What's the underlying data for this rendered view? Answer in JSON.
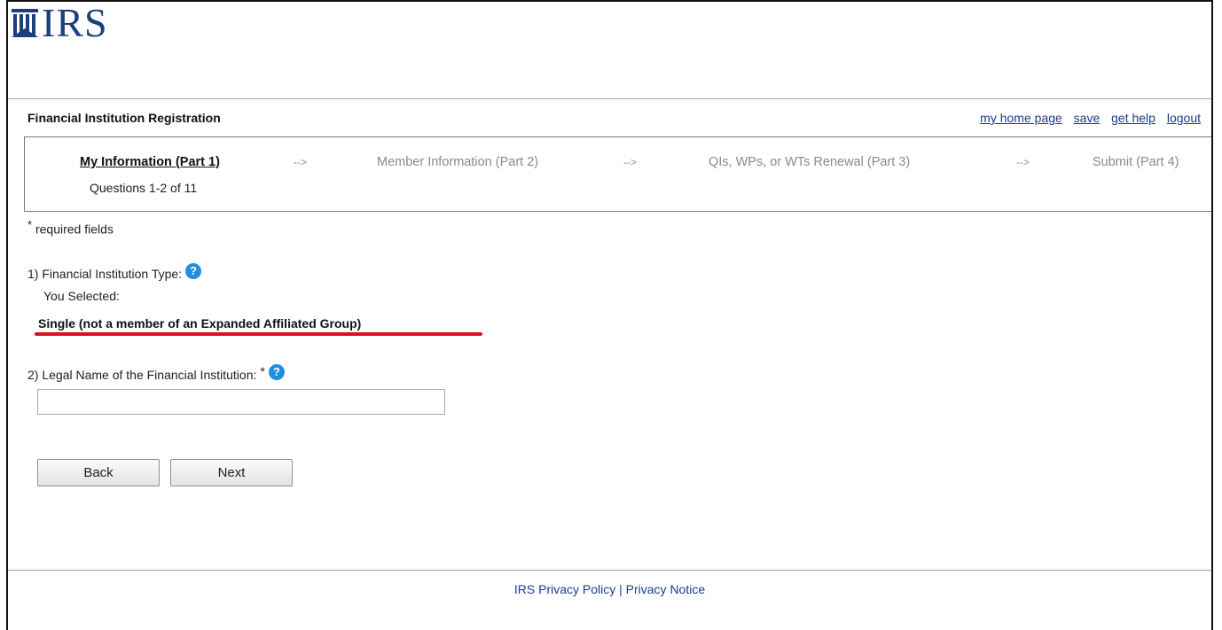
{
  "header": {
    "logo_text": "IRS",
    "app_title": "Financial Institution Registration",
    "links": [
      "my home page",
      "save",
      "get help",
      "logout"
    ]
  },
  "steps": {
    "items": [
      {
        "label": "My Information (Part 1)",
        "current": true
      },
      {
        "label": "Member Information (Part 2)",
        "current": false
      },
      {
        "label": "QIs, WPs, or WTs Renewal (Part 3)",
        "current": false
      },
      {
        "label": "Submit (Part 4)",
        "current": false
      }
    ],
    "arrow": "-->",
    "progress_text": "Questions 1-2 of 11"
  },
  "form": {
    "required_note_mark": "*",
    "required_note_text": "required fields",
    "q1_label": "1) Financial Institution Type:",
    "q1_you_selected": "You Selected:",
    "q1_value": "Single (not a member of an Expanded Affiliated Group)",
    "q2_label": "2) Legal Name of the Financial Institution:",
    "q2_required_mark": "*",
    "q2_value": "",
    "help_icon_glyph": "?",
    "back_label": "Back",
    "next_label": "Next"
  },
  "footer": {
    "privacy_policy": "IRS Privacy Policy",
    "separator": "|",
    "privacy_notice": "Privacy Notice"
  },
  "colors": {
    "link": "#1b3b8f",
    "logo": "#1a3f7a",
    "help_icon": "#1f8fe0",
    "annotation_underline": "#d4141c"
  }
}
